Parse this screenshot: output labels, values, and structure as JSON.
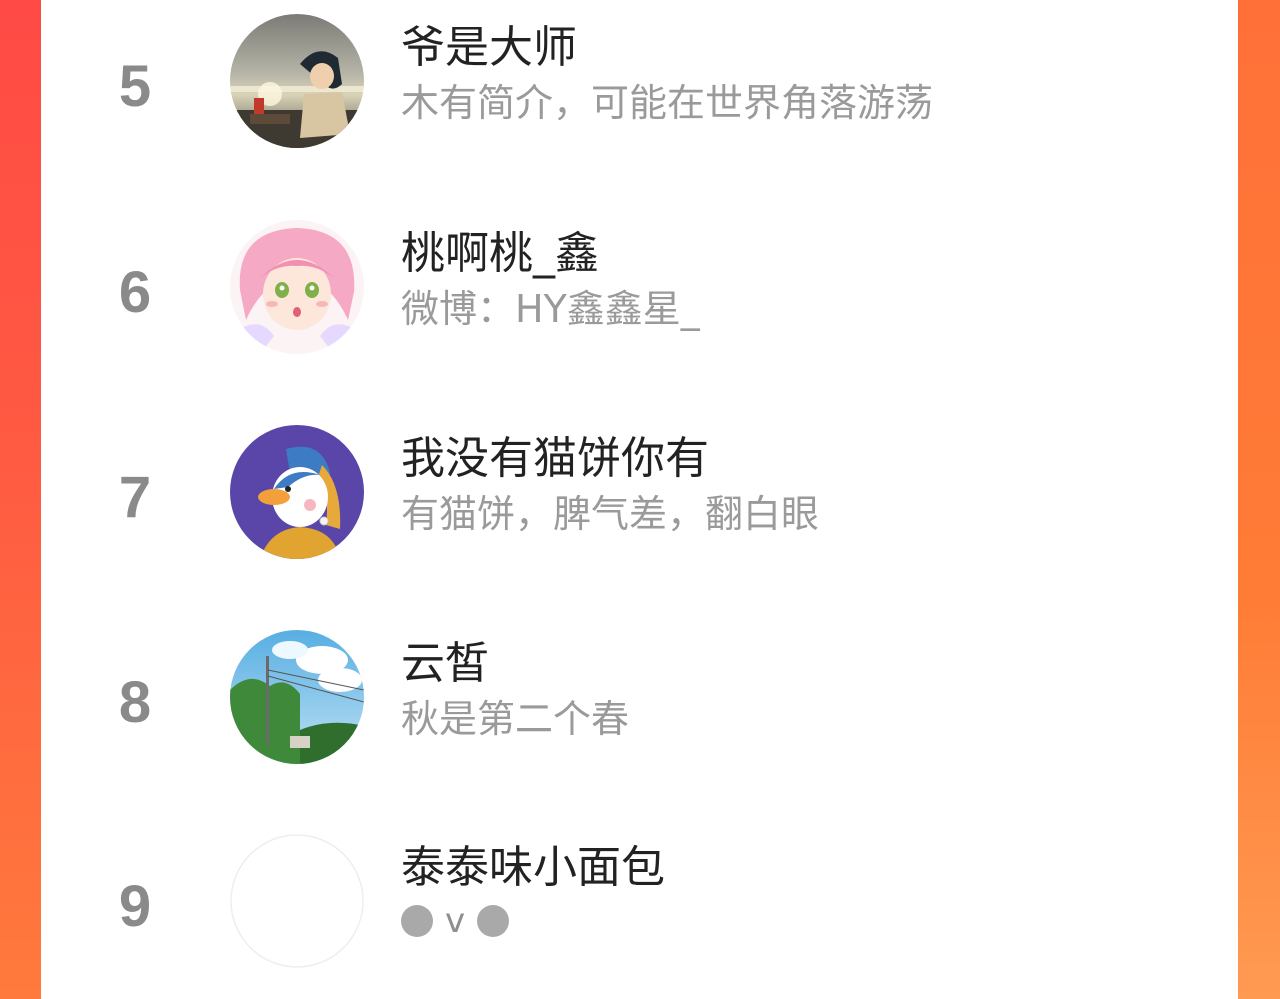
{
  "leaderboard": {
    "rows": [
      {
        "rank": "5",
        "name": "爷是大师",
        "bio": "木有简介，可能在世界角落游荡",
        "avatar_icon": "anime-boy-sunset-avatar"
      },
      {
        "rank": "6",
        "name": "桃啊桃_鑫",
        "bio": "微博：HY鑫鑫星_",
        "avatar_icon": "pink-hair-anime-girl-avatar"
      },
      {
        "rank": "7",
        "name": "我没有猫饼你有",
        "bio": "有猫饼，脾气差，翻白眼",
        "avatar_icon": "duck-pearl-earring-avatar"
      },
      {
        "rank": "8",
        "name": "云皙",
        "bio": "秋是第二个春",
        "avatar_icon": "sky-trees-powerline-avatar"
      },
      {
        "rank": "9",
        "name": "泰泰味小面包",
        "bio_glyph": "v",
        "avatar_icon": "blank-avatar"
      }
    ]
  },
  "colors": {
    "accent_left": "#ff4a45",
    "accent_right": "#ff7c36",
    "rank_text": "#8a8a8a",
    "name_text": "#222222",
    "bio_text": "#9a9a9a"
  }
}
